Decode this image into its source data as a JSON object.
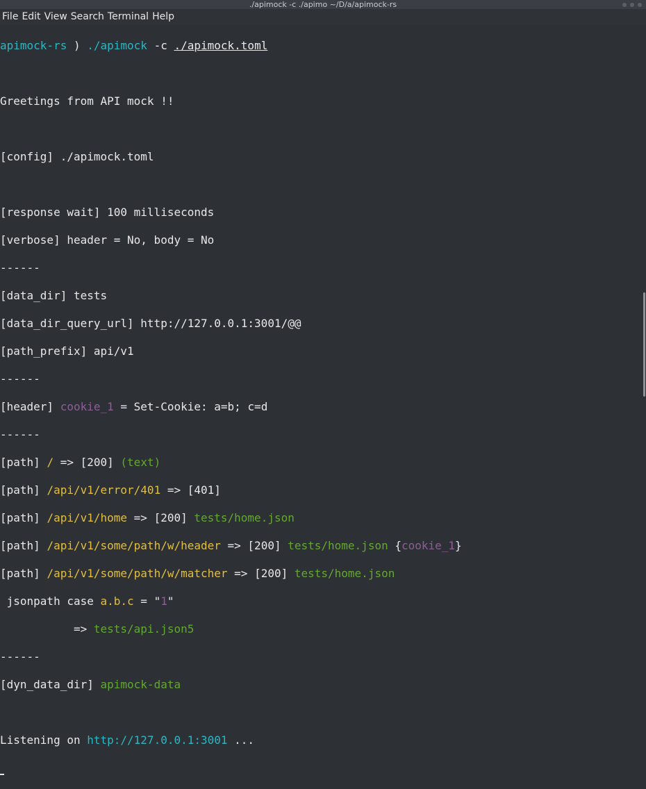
{
  "window": {
    "title": "./apimock -c ./apimo ~/D/a/apimock-rs"
  },
  "menu": [
    "File",
    "Edit",
    "View",
    "Search",
    "Terminal",
    "Help"
  ],
  "colors": {
    "cyan": "#2bb6c3",
    "yellow": "#e3bf3b",
    "green": "#63a82e",
    "purple": "#8d5f94",
    "text": "#e8e8e8",
    "background": "#2d3136"
  },
  "prompt": {
    "dir": "apimock-rs",
    "sep": " ) ",
    "cmd": "./apimock",
    "flag": " -c ",
    "arg": "./apimock.toml"
  },
  "greeting": "Greetings from API mock !!",
  "config": "[config] ./apimock.toml",
  "response_wait": "[response wait] 100 milliseconds",
  "verbose": "[verbose] header = No, body = No",
  "separator": "------",
  "data_dir": "[data_dir] tests",
  "data_dir_query_url": "[data_dir_query_url] http://127.0.0.1:3001/@@",
  "path_prefix": "[path_prefix] api/v1",
  "header": {
    "label": "[header] ",
    "name": "cookie_1",
    "value": " = Set-Cookie: a=b; c=d"
  },
  "paths": [
    {
      "label": "[path] ",
      "route": "/",
      "arrow": " => ",
      "status": "[200]",
      "extra": " (text)"
    },
    {
      "label": "[path] ",
      "route": "/api/v1/error/401",
      "arrow": " => ",
      "status": "[401]"
    },
    {
      "label": "[path] ",
      "route": "/api/v1/home",
      "arrow": " => ",
      "status": "[200] ",
      "file": "tests/home.json"
    },
    {
      "label": "[path] ",
      "route": "/api/v1/some/path/w/header",
      "arrow": " => ",
      "status": "[200] ",
      "file": "tests/home.json",
      "brace_open": " {",
      "cookie": "cookie_1",
      "brace_close": "}"
    },
    {
      "label": "[path] ",
      "route": "/api/v1/some/path/w/matcher",
      "arrow": " => ",
      "status": "[200] ",
      "file": "tests/home.json"
    }
  ],
  "jsonpath": {
    "prefix": " jsonpath case ",
    "key": "a.b.c",
    "eq": " = \"",
    "value": "1",
    "quote": "\"",
    "arrow": "           => ",
    "file": "tests/api.json5"
  },
  "dyn_data_dir": {
    "label": "[dyn_data_dir] ",
    "value": "apimock-data"
  },
  "listening": {
    "label": "Listening on ",
    "url": "http://127.0.0.1:3001",
    "suffix": " ..."
  }
}
